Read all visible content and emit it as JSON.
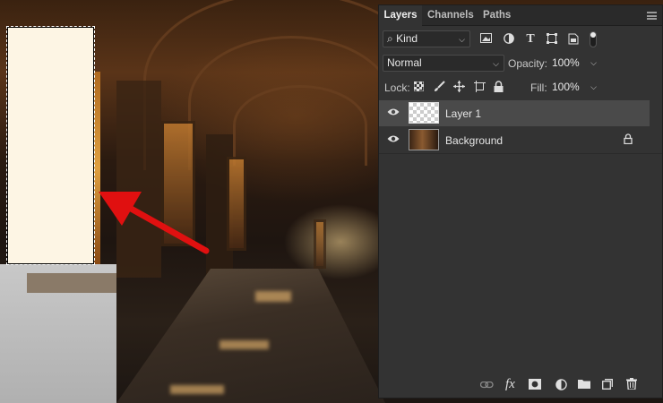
{
  "panel": {
    "tabs": [
      {
        "label": "Layers",
        "active": true
      },
      {
        "label": "Channels",
        "active": false
      },
      {
        "label": "Paths",
        "active": false
      }
    ],
    "filter": {
      "prefix": "⌕",
      "kind_label": "Kind"
    },
    "blend_mode": "Normal",
    "opacity_label": "Opacity:",
    "opacity_value": "100%",
    "lock_label": "Lock:",
    "fill_label": "Fill:",
    "fill_value": "100%",
    "layers": [
      {
        "name": "Layer 1",
        "visible": true,
        "selected": true,
        "locked": false
      },
      {
        "name": "Background",
        "visible": true,
        "selected": false,
        "locked": true
      }
    ],
    "filter_icons": [
      "pixel-filter-icon",
      "adjustment-filter-icon",
      "type-filter-icon",
      "shape-filter-icon",
      "smart-object-filter-icon"
    ],
    "bottom_icons": [
      "link-icon",
      "fx-icon",
      "mask-icon",
      "adjustment-icon",
      "folder-icon",
      "new-layer-icon",
      "trash-icon"
    ],
    "fx_label": "fx",
    "type_glyph": "T"
  },
  "colors": {
    "panel_bg": "#333333",
    "selected_row": "#4a4a4a",
    "arrow": "#e01010",
    "selection_fill": "#fdf5e4"
  }
}
